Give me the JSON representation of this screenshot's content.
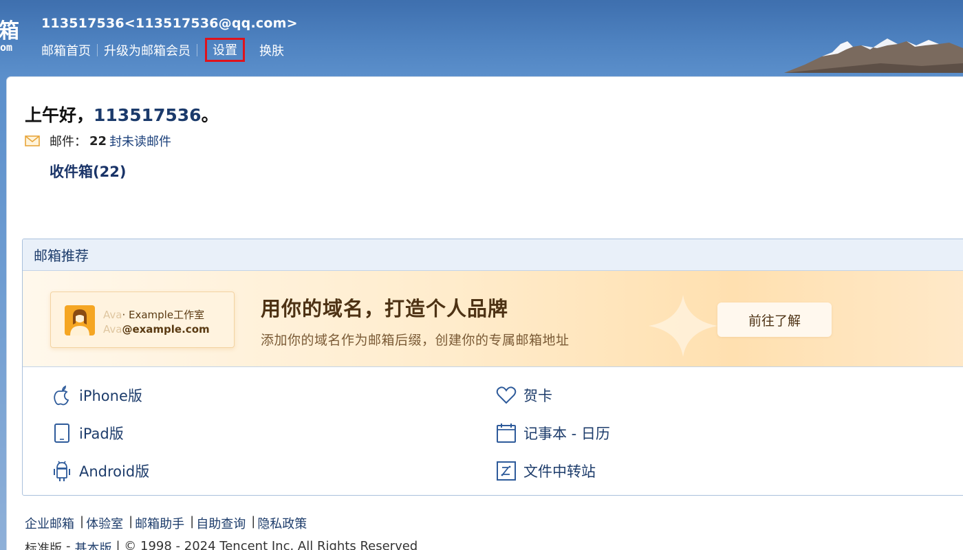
{
  "header": {
    "logo_char": "箱",
    "logo_sub": "om",
    "account": "113517536<113517536@qq.com>",
    "nav": [
      {
        "label": "邮箱首页"
      },
      {
        "label": "升级为邮箱会员"
      },
      {
        "label": "设置"
      },
      {
        "label": "换肤"
      }
    ]
  },
  "main": {
    "greeting_prefix": "上午好，",
    "username": "113517536",
    "greeting_suffix": "。",
    "mail_label": "邮件：",
    "unread_count": "22",
    "unread_text": "封未读邮件",
    "inbox_link": "收件箱(22)"
  },
  "recommend": {
    "title": "邮箱推荐",
    "banner": {
      "card_ghost1": "Ava",
      "card_line1": "· Example工作室",
      "card_ghost2": "Ava",
      "card_line2": "@example.com",
      "title": "用你的域名，打造个人品牌",
      "subtitle": "添加你的域名作为邮箱后缀，创建你的专属邮箱地址",
      "button": "前往了解"
    },
    "links": [
      {
        "label": "iPhone版",
        "icon": "apple-icon"
      },
      {
        "label": "iPad版",
        "icon": "tablet-icon"
      },
      {
        "label": "Android版",
        "icon": "android-icon"
      },
      {
        "label": "贺卡",
        "icon": "heart-icon"
      },
      {
        "label": "记事本 - 日历",
        "icon": "calendar-icon"
      },
      {
        "label": "文件中转站",
        "icon": "file-transfer-icon"
      }
    ]
  },
  "footer": {
    "links": [
      "企业邮箱",
      "体验室",
      "邮箱助手",
      "自助查询",
      "隐私政策"
    ],
    "edition_standard": "标准版",
    "dash": "-",
    "edition_basic": "基本版",
    "copyright": "| © 1998 - 2024 Tencent Inc. All Rights Reserved"
  },
  "colors": {
    "header_bg": "#4e82c0",
    "link": "#1d3c6b",
    "highlight_box": "#e0121b"
  }
}
